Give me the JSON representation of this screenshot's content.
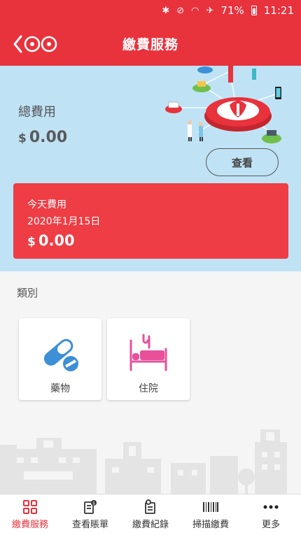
{
  "status_bar": {
    "battery": "71%",
    "time": "11:21"
  },
  "header": {
    "title": "繳費服務"
  },
  "summary": {
    "label": "總費用",
    "currency": "$",
    "amount": "0.00",
    "view_button": "查看"
  },
  "today": {
    "title": "今天費用",
    "date": "2020年1月15日",
    "currency": "$",
    "amount": "0.00"
  },
  "categories": {
    "label": "類別",
    "items": [
      {
        "label": "藥物",
        "icon": "pill-icon"
      },
      {
        "label": "住院",
        "icon": "hospital-bed-icon"
      }
    ]
  },
  "tabs": [
    {
      "label": "繳費服務",
      "icon": "payment-service-icon",
      "active": true
    },
    {
      "label": "查看賬單",
      "icon": "bill-icon",
      "active": false
    },
    {
      "label": "繳費紀錄",
      "icon": "record-icon",
      "active": false
    },
    {
      "label": "掃描繳費",
      "icon": "barcode-icon",
      "active": false
    },
    {
      "label": "更多",
      "icon": "more-icon",
      "active": false
    }
  ],
  "colors": {
    "brand_red": "#e8323c",
    "card_red": "#ee3d44",
    "summary_blue": "#bfe3f5",
    "icon_blue": "#3d8fd6",
    "icon_pink": "#e8509a"
  }
}
